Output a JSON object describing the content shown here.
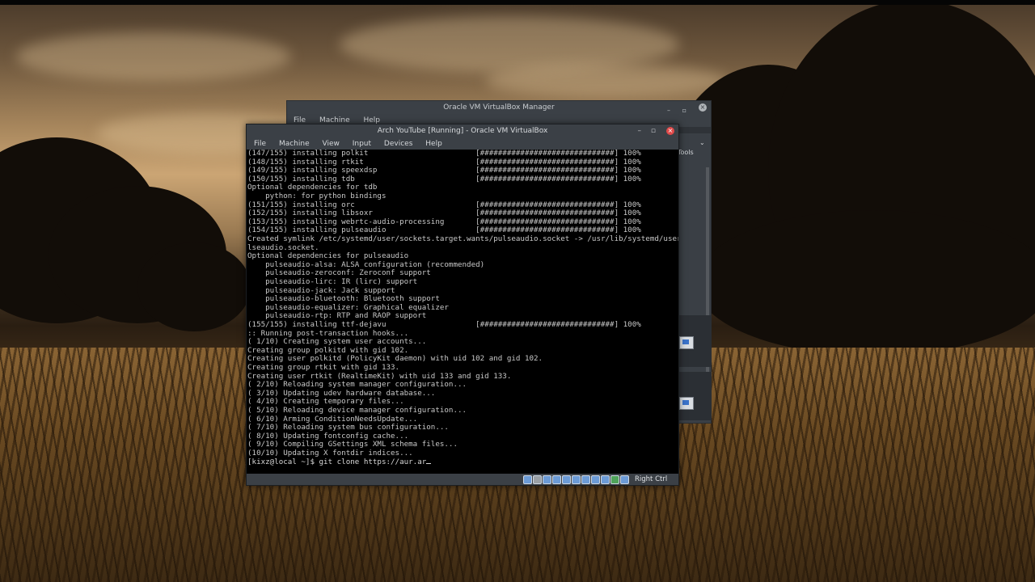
{
  "manager": {
    "title": "Oracle VM VirtualBox Manager",
    "menu": [
      "File",
      "Machine",
      "Help"
    ],
    "tools_label": "Tools"
  },
  "vm": {
    "title": "Arch YouTube [Running] - Oracle VM VirtualBox",
    "menu": [
      "File",
      "Machine",
      "View",
      "Input",
      "Devices",
      "Help"
    ],
    "host_key": "Right Ctrl"
  },
  "terminal": {
    "lines": [
      "(147/155) installing polkit                        [##############################] 100%",
      "(148/155) installing rtkit                         [##############################] 100%",
      "(149/155) installing speexdsp                      [##############################] 100%",
      "(150/155) installing tdb                           [##############################] 100%",
      "Optional dependencies for tdb",
      "    python: for python bindings",
      "(151/155) installing orc                           [##############################] 100%",
      "(152/155) installing libsoxr                       [##############################] 100%",
      "(153/155) installing webrtc-audio-processing       [##############################] 100%",
      "(154/155) installing pulseaudio                    [##############################] 100%",
      "Created symlink /etc/systemd/user/sockets.target.wants/pulseaudio.socket -> /usr/lib/systemd/user/pu",
      "lseaudio.socket.",
      "Optional dependencies for pulseaudio",
      "    pulseaudio-alsa: ALSA configuration (recommended)",
      "    pulseaudio-zeroconf: Zeroconf support",
      "    pulseaudio-lirc: IR (lirc) support",
      "    pulseaudio-jack: Jack support",
      "    pulseaudio-bluetooth: Bluetooth support",
      "    pulseaudio-equalizer: Graphical equalizer",
      "    pulseaudio-rtp: RTP and RAOP support",
      "(155/155) installing ttf-dejavu                    [##############################] 100%",
      ":: Running post-transaction hooks...",
      "( 1/10) Creating system user accounts...",
      "Creating group polkitd with gid 102.",
      "Creating user polkitd (PolicyKit daemon) with uid 102 and gid 102.",
      "Creating group rtkit with gid 133.",
      "Creating user rtkit (RealtimeKit) with uid 133 and gid 133.",
      "( 2/10) Reloading system manager configuration...",
      "( 3/10) Updating udev hardware database...",
      "( 4/10) Creating temporary files...",
      "( 5/10) Reloading device manager configuration...",
      "( 6/10) Arming ConditionNeedsUpdate...",
      "( 7/10) Reloading system bus configuration...",
      "( 8/10) Updating fontconfig cache...",
      "( 9/10) Compiling GSettings XML schema files...",
      "(10/10) Updating X fontdir indices..."
    ],
    "prompt": "[kixz@local ~]$ git clone https://aur.ar"
  }
}
